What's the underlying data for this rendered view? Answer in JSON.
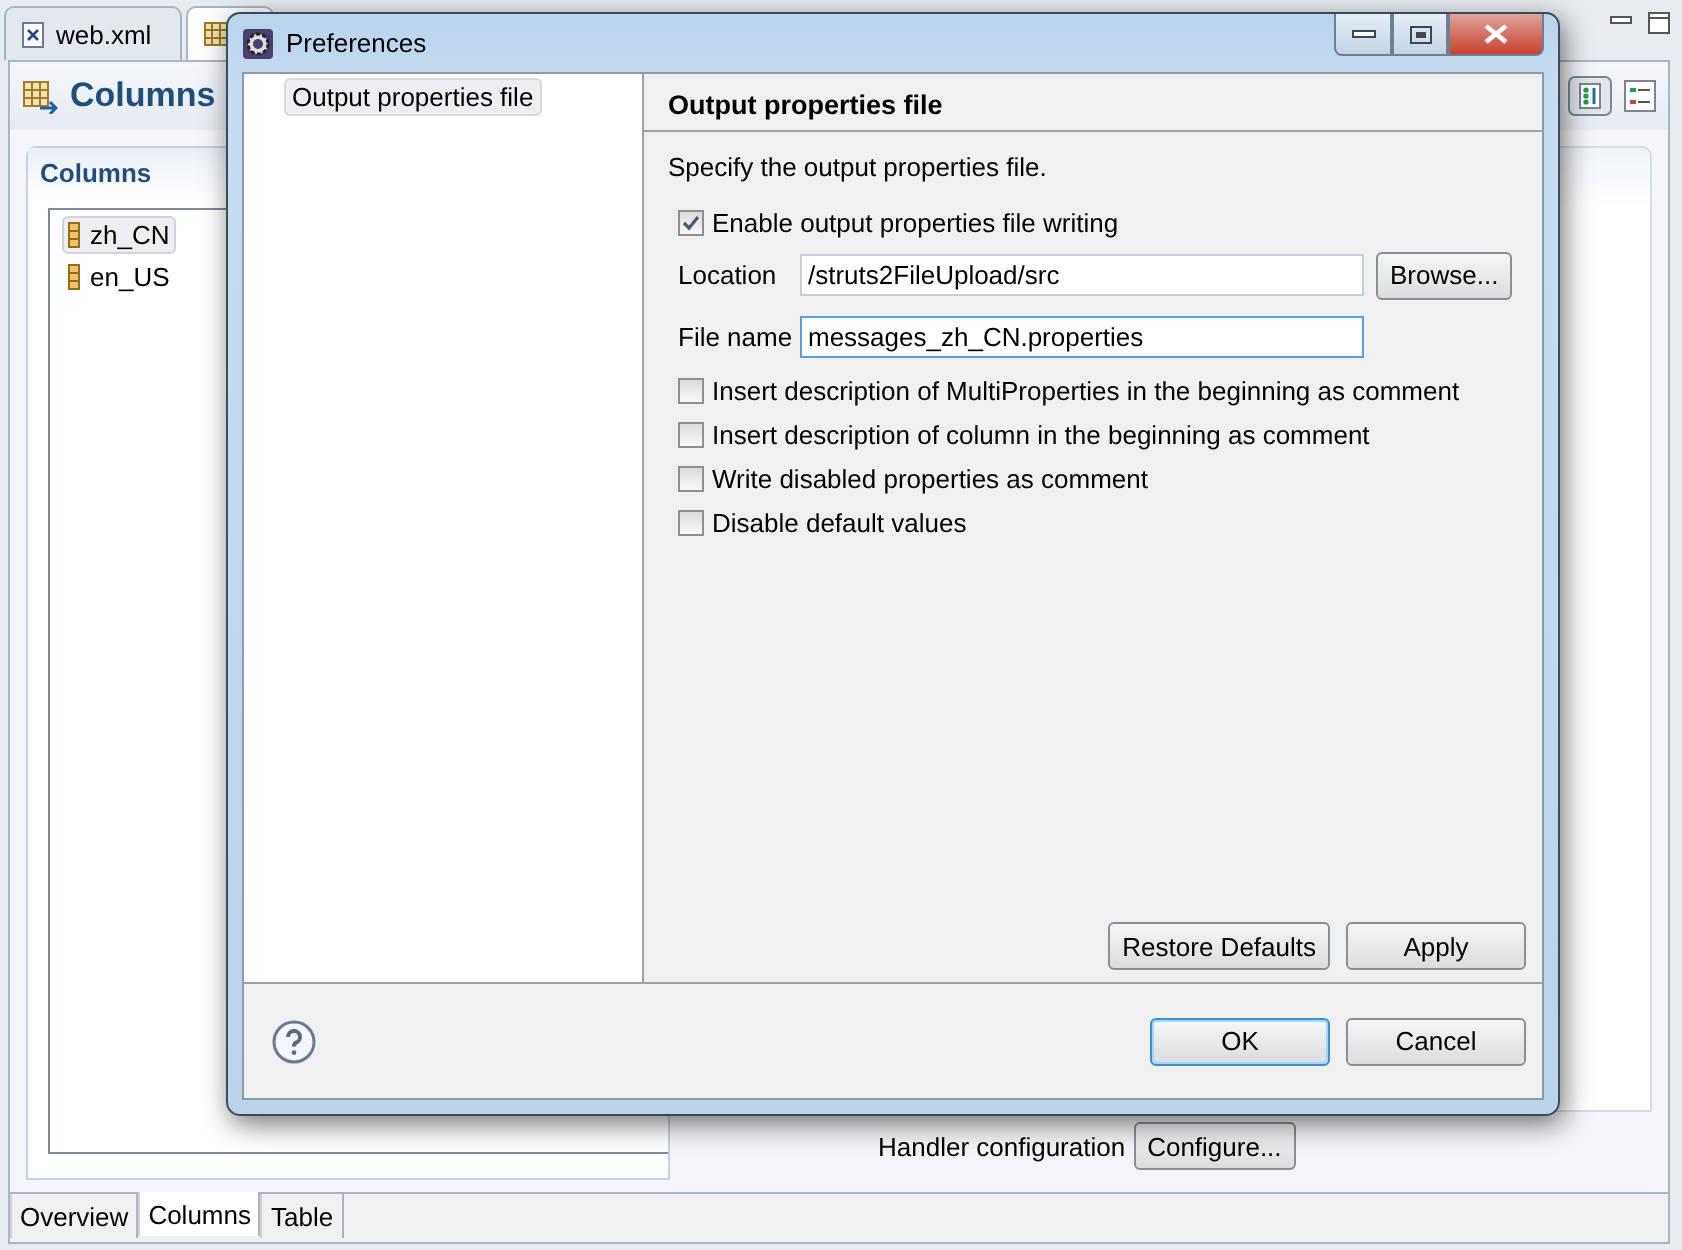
{
  "editor": {
    "tabs": [
      {
        "label": "web.xml",
        "selected": false
      }
    ],
    "title": "Columns",
    "section_title": "Columns",
    "columns": [
      {
        "label": "zh_CN",
        "selected": true
      },
      {
        "label": "en_US",
        "selected": false
      }
    ],
    "handler_label": "Handler configuration",
    "configure_button": "Configure...",
    "bottom_tabs": [
      {
        "label": "Overview",
        "selected": false
      },
      {
        "label": "Columns",
        "selected": true
      },
      {
        "label": "Table",
        "selected": false
      }
    ]
  },
  "dialog": {
    "title": "Preferences",
    "tree": [
      {
        "label": "Output properties file",
        "selected": true
      }
    ],
    "page_title": "Output properties file",
    "description": "Specify the output properties file.",
    "enable": {
      "label": "Enable output properties file writing",
      "checked": true
    },
    "fields": [
      {
        "label": "Location",
        "value": "/struts2FileUpload/src",
        "button": "Browse...",
        "focused": false
      },
      {
        "label": "File name",
        "value": "messages_zh_CN.properties",
        "focused": true
      }
    ],
    "options": [
      {
        "label": "Insert description of MultiProperties in the beginning as comment",
        "checked": false
      },
      {
        "label": "Insert description of column in the beginning as comment",
        "checked": false
      },
      {
        "label": "Write disabled properties as comment",
        "checked": false
      },
      {
        "label": "Disable default values",
        "checked": false
      }
    ],
    "page_buttons": [
      "Restore Defaults",
      "Apply"
    ],
    "buttons": [
      {
        "label": "OK",
        "default": true
      },
      {
        "label": "Cancel",
        "default": false
      }
    ]
  }
}
